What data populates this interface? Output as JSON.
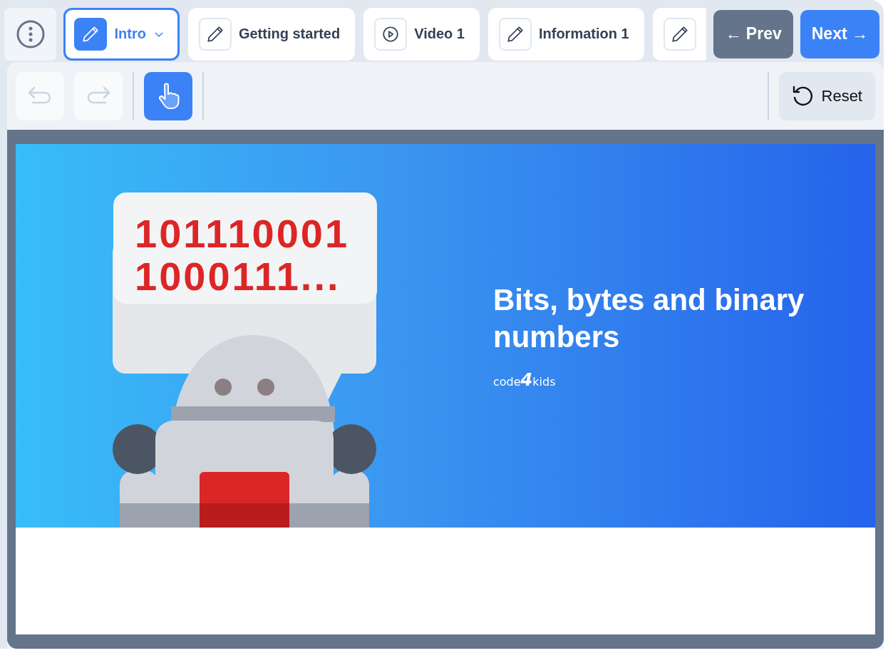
{
  "tabs": [
    {
      "kind": "pencil",
      "label": "Intro",
      "selected": true
    },
    {
      "kind": "pencil",
      "label": "Getting started",
      "selected": false
    },
    {
      "kind": "video",
      "label": "Video 1",
      "selected": false
    },
    {
      "kind": "pencil",
      "label": "Information 1",
      "selected": false
    },
    {
      "kind": "pencil",
      "selected": false
    }
  ],
  "nav": {
    "prev": "← Prev",
    "next": "Next →"
  },
  "toolbar": {
    "undo": {
      "disabled": true
    },
    "redo": {
      "disabled": true
    },
    "hand": {
      "selected": true
    },
    "reset": "Reset"
  },
  "slide": {
    "bubble_lines": [
      "101110001",
      "1000111..."
    ],
    "title": "Bits, bytes and binary numbers",
    "logo": "code**4**kids"
  }
}
